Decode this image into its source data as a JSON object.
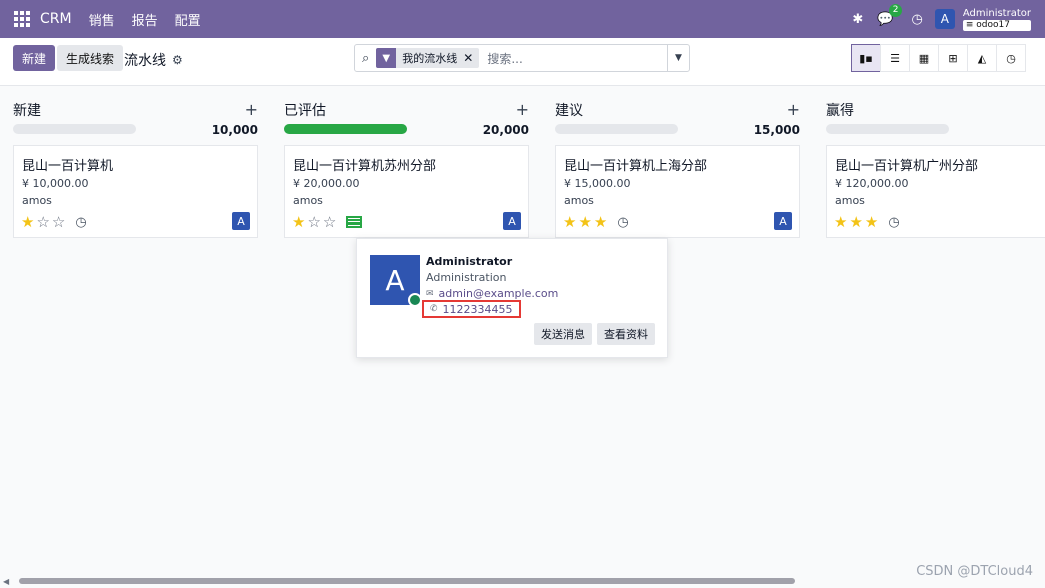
{
  "navbar": {
    "brand": "CRM",
    "menu": [
      "销售",
      "报告",
      "配置"
    ],
    "chat_badge": "2",
    "avatar_letter": "A",
    "user_name": "Administrator",
    "db_name": "odoo17"
  },
  "control": {
    "new_label": "新建",
    "generate_label": "生成线索",
    "breadcrumb": "流水线",
    "search": {
      "facet_label": "我的流水线",
      "placeholder": "搜索..."
    },
    "views": [
      "kanban",
      "list",
      "calendar",
      "pivot",
      "graph",
      "activity"
    ]
  },
  "columns": [
    {
      "title": "新建",
      "sum": "10,000",
      "progress": 0,
      "card": {
        "title": "昆山一百计算机",
        "amount": "¥ 10,000.00",
        "contact": "amos",
        "stars": 1,
        "activity": "clock",
        "avatar": "A"
      }
    },
    {
      "title": "已评估",
      "sum": "20,000",
      "progress": 100,
      "card": {
        "title": "昆山一百计算机苏州分部",
        "amount": "¥ 20,000.00",
        "contact": "amos",
        "stars": 1,
        "activity": "planned",
        "avatar": "A"
      }
    },
    {
      "title": "建议",
      "sum": "15,000",
      "progress": 0,
      "card": {
        "title": "昆山一百计算机上海分部",
        "amount": "¥ 15,000.00",
        "contact": "amos",
        "stars": 3,
        "activity": "clock",
        "avatar": "A"
      }
    },
    {
      "title": "赢得",
      "sum": "",
      "progress": 0,
      "card": {
        "title": "昆山一百计算机广州分部",
        "amount": "¥ 120,000.00",
        "contact": "amos",
        "stars": 3,
        "activity": "clock",
        "avatar": ""
      }
    }
  ],
  "popover": {
    "avatar_letter": "A",
    "name": "Administrator",
    "department": "Administration",
    "email": "admin@example.com",
    "phone": "1122334455",
    "send_message_label": "发送消息",
    "view_profile_label": "查看资料"
  },
  "watermark": "CSDN @DTCloud4",
  "colors": {
    "brand": "#71639e",
    "progress": "#28a745",
    "avatar": "#2f55b0",
    "star": "#f3c317",
    "highlight": "#e53935"
  }
}
